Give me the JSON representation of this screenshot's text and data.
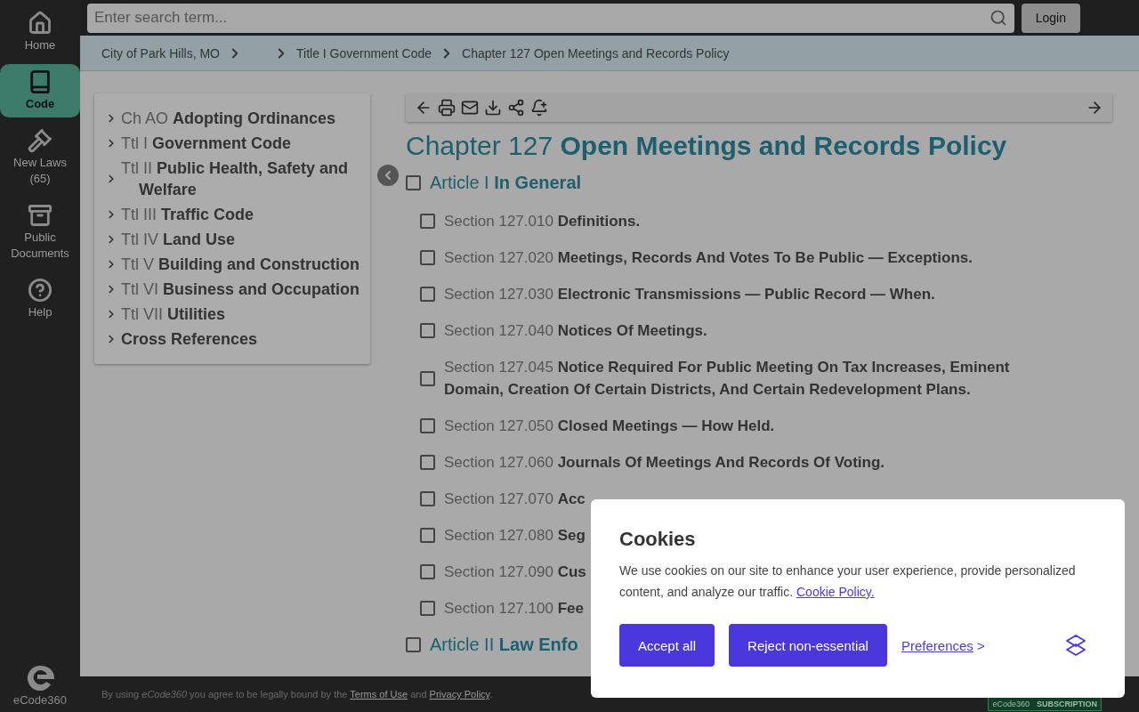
{
  "nav": [
    {
      "label": "Home",
      "selected": false
    },
    {
      "label": "Code",
      "selected": true
    },
    {
      "label": "New Laws (65)",
      "selected": false
    },
    {
      "label": "Public Documents",
      "selected": false
    },
    {
      "label": "Help",
      "selected": false
    }
  ],
  "brand": "eCode360",
  "search": {
    "placeholder": "Enter search term..."
  },
  "login": "Login",
  "breadcrumbs": [
    "City of Park Hills, MO",
    "Title I Government Code",
    "Chapter 127 Open Meetings and Records Policy"
  ],
  "toc": [
    {
      "prefix": "Ch AO",
      "title": "Adopting Ordinances"
    },
    {
      "prefix": "Ttl I",
      "title": "Government Code"
    },
    {
      "prefix": "Ttl II",
      "title": "Public Health, Safety and Welfare"
    },
    {
      "prefix": "Ttl III",
      "title": "Traffic Code"
    },
    {
      "prefix": "Ttl IV",
      "title": "Land Use"
    },
    {
      "prefix": "Ttl V",
      "title": "Building and Construction"
    },
    {
      "prefix": "Ttl VI",
      "title": "Business and Occupation"
    },
    {
      "prefix": "Ttl VII",
      "title": "Utilities"
    },
    {
      "title": "Cross References"
    }
  ],
  "chapter": {
    "number": "Chapter 127",
    "title": "Open Meetings and Records Policy"
  },
  "entries": [
    {
      "kind": "article",
      "number": "Article I",
      "title": "In General",
      "checked": false
    },
    {
      "kind": "section",
      "number": "Section 127.010",
      "title": "Definitions.",
      "checked": false
    },
    {
      "kind": "section",
      "number": "Section 127.020",
      "title": "Meetings, Records And Votes To Be Public — Exceptions.",
      "checked": false
    },
    {
      "kind": "section",
      "number": "Section 127.030",
      "title": "Electronic Transmissions — Public Record — When.",
      "checked": false
    },
    {
      "kind": "section",
      "number": "Section 127.040",
      "title": "Notices Of Meetings.",
      "checked": false
    },
    {
      "kind": "section",
      "number": "Section 127.045",
      "title": "Notice Required For Public Meeting On Tax Increases, Eminent Domain, Creation Of Certain Districts, And Certain Redevelopment Plans.",
      "checked": false
    },
    {
      "kind": "section",
      "number": "Section 127.050",
      "title": "Closed Meetings — How Held.",
      "checked": false
    },
    {
      "kind": "section",
      "number": "Section 127.060",
      "title": "Journals Of Meetings And Records Of Voting.",
      "checked": false
    },
    {
      "kind": "section",
      "number": "Section 127.070",
      "title": "Acc",
      "checked": false
    },
    {
      "kind": "section",
      "number": "Section 127.080",
      "title": "Seg",
      "checked": false
    },
    {
      "kind": "section",
      "number": "Section 127.090",
      "title": "Cus",
      "checked": false
    },
    {
      "kind": "section",
      "number": "Section 127.100",
      "title": "Fee",
      "checked": false
    },
    {
      "kind": "article",
      "number": "Article II",
      "title": "Law Enfo",
      "checked": false
    }
  ],
  "footer": {
    "before": "By using",
    "brand": "eCode360",
    "middle": "you agree to be legally bound by the",
    "terms": "Terms of Use",
    "and": "and",
    "privacy": "Privacy Policy",
    "end": "."
  },
  "badge": {
    "brand": "eCode360",
    "label": "SUBSCRIPTION"
  },
  "cookies": {
    "title": "Cookies",
    "text": "We use cookies on our site to enhance your user experience, provide personalized content, and analyze our traffic.",
    "policy": "Cookie Policy.",
    "accept": "Accept all",
    "reject": "Reject non-essential",
    "preferences": "Preferences",
    "preferences_arrow": ">"
  }
}
